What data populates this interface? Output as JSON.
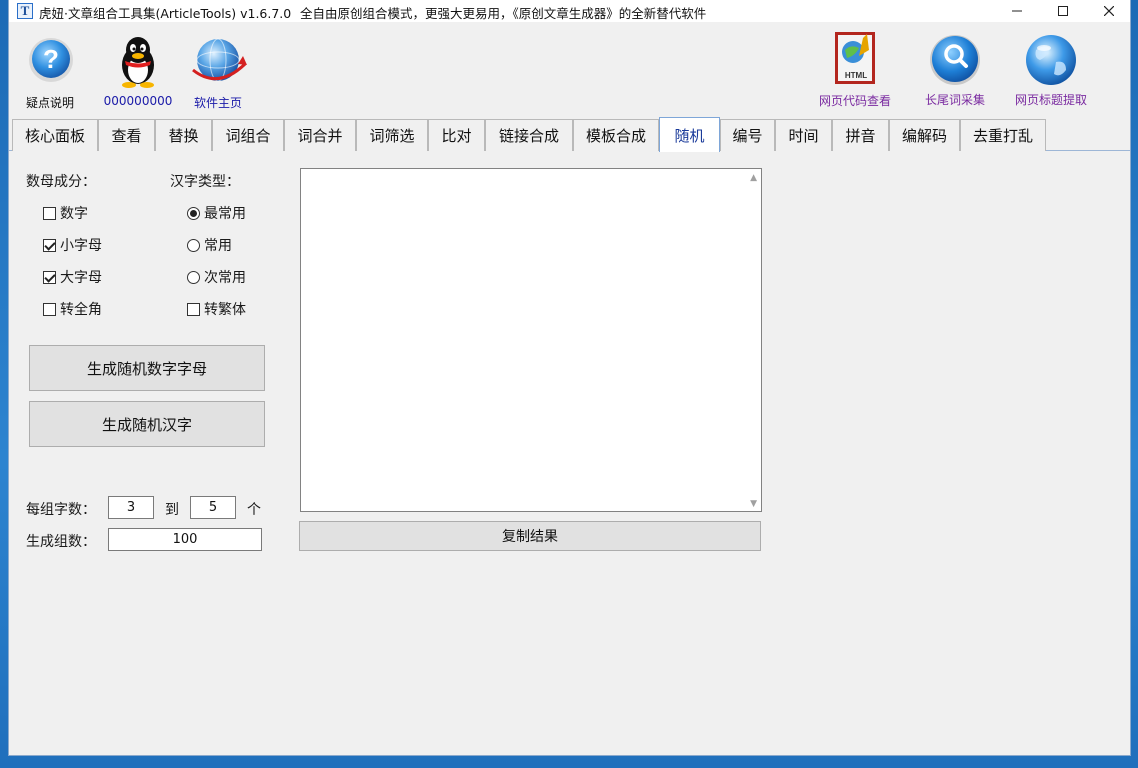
{
  "window": {
    "title": "虎妞·文章组合工具集(ArticleTools) v1.6.7.0",
    "subtitle": "全自由原创组合模式，更强大更易用，《原创文章生成器》的全新替代软件",
    "app_icon_letter": "T"
  },
  "toolbar": {
    "help_label": "疑点说明",
    "qq_label": "000000000",
    "homepage_label": "软件主页",
    "html_view_label": "网页代码查看",
    "longtail_label": "长尾词采集",
    "title_extract_label": "网页标题提取",
    "html_icon_text": "HTML"
  },
  "tabs": [
    {
      "label": "核心面板"
    },
    {
      "label": "查看"
    },
    {
      "label": "替换"
    },
    {
      "label": "词组合"
    },
    {
      "label": "词合并"
    },
    {
      "label": "词筛选"
    },
    {
      "label": "比对"
    },
    {
      "label": "链接合成"
    },
    {
      "label": "模板合成"
    },
    {
      "label": "随机",
      "active": true
    },
    {
      "label": "编号"
    },
    {
      "label": "时间"
    },
    {
      "label": "拼音"
    },
    {
      "label": "编解码"
    },
    {
      "label": "去重打乱"
    }
  ],
  "random": {
    "digits_letters_label": "数母成分：",
    "hanzi_type_label": "汉字类型：",
    "options_left": [
      {
        "label": "数字",
        "checked": false
      },
      {
        "label": "小字母",
        "checked": true
      },
      {
        "label": "大字母",
        "checked": true
      },
      {
        "label": "转全角",
        "checked": false
      }
    ],
    "options_right": [
      {
        "label": "最常用",
        "checked": true
      },
      {
        "label": "常用",
        "checked": false
      },
      {
        "label": "次常用",
        "checked": false
      }
    ],
    "traditional_label": "转繁体",
    "traditional_checked": false,
    "gen_alnum_button": "生成随机数字字母",
    "gen_hanzi_button": "生成随机汉字",
    "per_group_label": "每组字数：",
    "min_chars": "3",
    "to_label": "到",
    "max_chars": "5",
    "unit_label": "个",
    "groups_label": "生成组数：",
    "groups_value": "100",
    "output_text": "",
    "copy_button": "复制结果"
  }
}
